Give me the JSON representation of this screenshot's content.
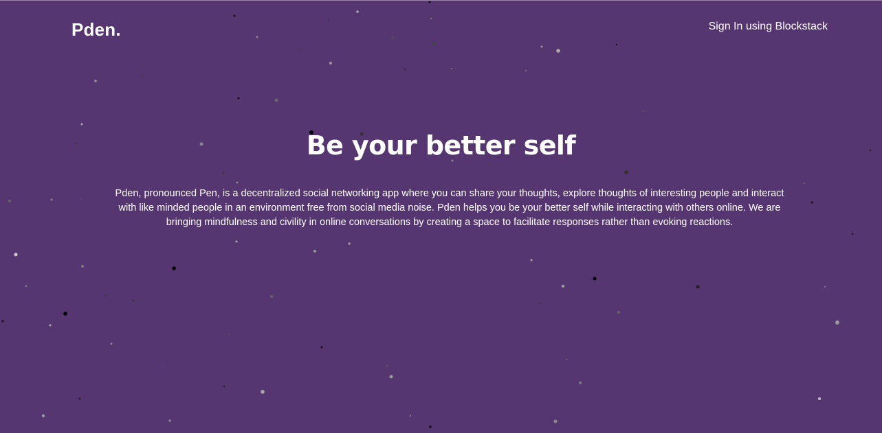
{
  "header": {
    "logo": "Pden.",
    "signin_label": "Sign In using Blockstack"
  },
  "hero": {
    "title": "Be your better self",
    "description": "Pden, pronounced Pen, is a decentralized social networking app where you can share your thoughts, explore thoughts of interesting people and interact with like minded people in an environment free from social media noise. Pden helps you be your better self while interacting with others online. We are bringing mindfulness and civility in online conversations by creating a space to facilitate responses rather than evoking reactions."
  },
  "colors": {
    "background": "#563670",
    "text": "#ffffff"
  }
}
